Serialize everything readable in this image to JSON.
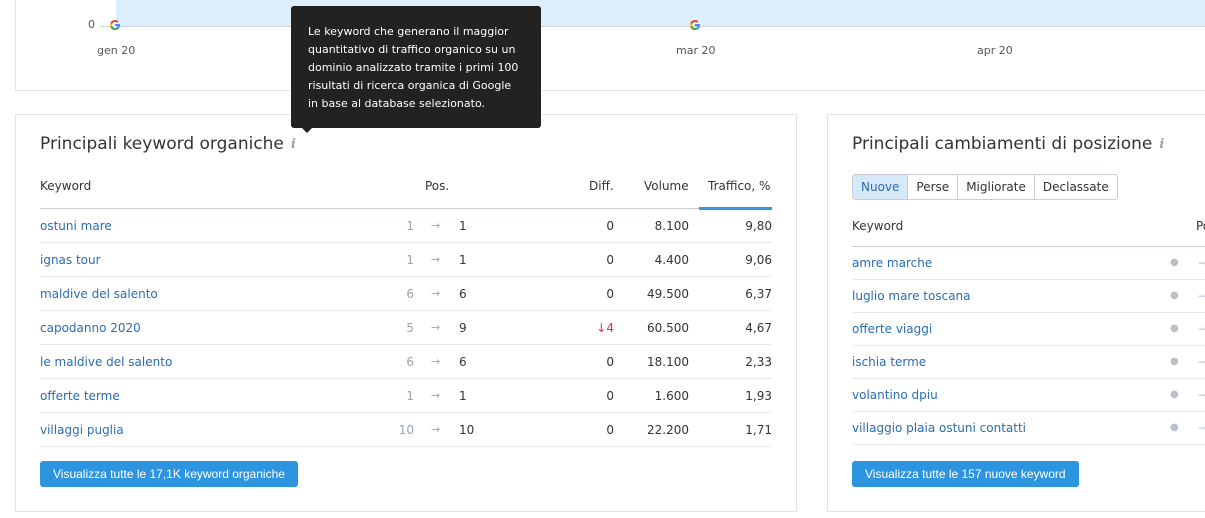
{
  "chart": {
    "y_zero": "0",
    "x_labels": [
      "gen 20",
      "mar 20",
      "apr 20"
    ]
  },
  "tooltip": {
    "text": "Le keyword che generano il maggior quantitativo di traffico organico su un dominio analizzato tramite i primi 100 risultati di ricerca organica di Google in base al database selezionato."
  },
  "organic": {
    "title": "Principali keyword organiche",
    "info": "i",
    "headers": {
      "keyword": "Keyword",
      "pos": "Pos.",
      "diff": "Diff.",
      "volume": "Volume",
      "traffic": "Traffico, %"
    },
    "rows": [
      {
        "keyword": "ostuni mare",
        "prev": "1",
        "arrow": "→",
        "pos": "1",
        "diff": "0",
        "volume": "8.100",
        "traffic": "9,80"
      },
      {
        "keyword": "ignas tour",
        "prev": "1",
        "arrow": "→",
        "pos": "1",
        "diff": "0",
        "volume": "4.400",
        "traffic": "9,06"
      },
      {
        "keyword": "maldive del salento",
        "prev": "6",
        "arrow": "→",
        "pos": "6",
        "diff": "0",
        "volume": "49.500",
        "traffic": "6,37"
      },
      {
        "keyword": "capodanno 2020",
        "prev": "5",
        "arrow": "→",
        "pos": "9",
        "diff": "↓4",
        "volume": "60.500",
        "traffic": "4,67"
      },
      {
        "keyword": "le maldive del salento",
        "prev": "6",
        "arrow": "→",
        "pos": "6",
        "diff": "0",
        "volume": "18.100",
        "traffic": "2,33"
      },
      {
        "keyword": "offerte terme",
        "prev": "1",
        "arrow": "→",
        "pos": "1",
        "diff": "0",
        "volume": "1.600",
        "traffic": "1,93"
      },
      {
        "keyword": "villaggi puglia",
        "prev": "10",
        "arrow": "→",
        "pos": "10",
        "diff": "0",
        "volume": "22.200",
        "traffic": "1,71"
      }
    ],
    "button": "Visualizza tutte le 17,1K keyword organiche"
  },
  "changes": {
    "title": "Principali cambiamenti di posizione",
    "info": "i",
    "tabs": [
      "Nuove",
      "Perse",
      "Migliorate",
      "Declassate"
    ],
    "active_tab": "Nuove",
    "headers": {
      "keyword": "Keyword",
      "pos": "Po"
    },
    "rows": [
      {
        "keyword": "amre marche",
        "dot": "●",
        "dash": "→"
      },
      {
        "keyword": "luglio mare toscana",
        "dot": "●",
        "dash": "→"
      },
      {
        "keyword": "offerte viaggi",
        "dot": "●",
        "dash": "→"
      },
      {
        "keyword": "ischia terme",
        "dot": "●",
        "dash": "→"
      },
      {
        "keyword": "volantino dpiu",
        "dot": "●",
        "dash": "→"
      },
      {
        "keyword": "villaggio plaia ostuni contatti",
        "dot": "●",
        "dash": "→"
      }
    ],
    "button": "Visualizza tutte le 157 nuove keyword"
  },
  "colors": {
    "accent": "#2d95e0",
    "link": "#2a6db2",
    "negative": "#e23636",
    "chart_fill": "#dcedfb"
  }
}
